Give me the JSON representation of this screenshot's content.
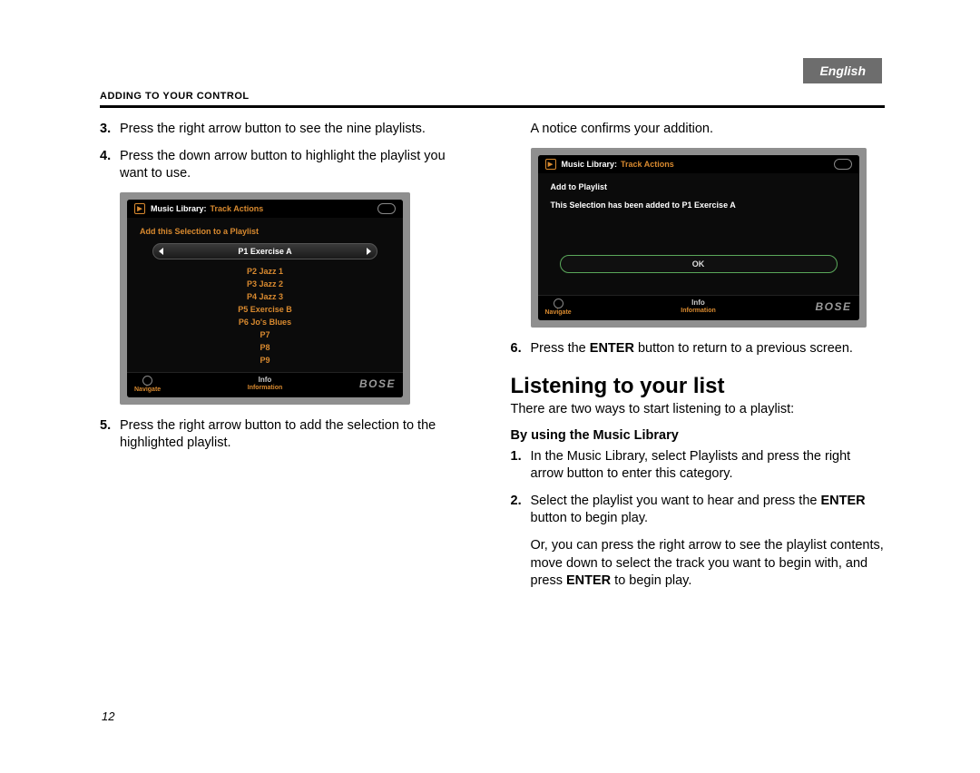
{
  "language_tab": "English",
  "section_header": "Adding to Your Control",
  "page_number": "12",
  "left": {
    "step3": {
      "num": "3.",
      "text": "Press the right arrow button to see the nine playlists."
    },
    "step4": {
      "num": "4.",
      "text": "Press the down arrow button to highlight the playlist you want to use."
    },
    "step5": {
      "num": "5.",
      "text": "Press the right arrow button to add the selection to the highlighted playlist."
    }
  },
  "right": {
    "notice": "A notice confirms your addition.",
    "step6": {
      "num": "6.",
      "text_a": "Press the ",
      "bold1": "ENTER",
      "text_b": " button to return to a previous screen."
    },
    "heading": "Listening to your list",
    "intro": "There are two ways to start listening to a playlist:",
    "subhead": "By using the Music Library",
    "s1": {
      "num": "1.",
      "text": "In the Music Library, select Playlists and press the right arrow button to enter this category."
    },
    "s2": {
      "num": "2.",
      "text_a": "Select the playlist you want to hear and press the ",
      "bold1": "ENTER",
      "text_b": " button to begin play."
    },
    "or": {
      "text_a": "Or, you can press the right arrow to see the playlist contents, move down to select the track you want to begin with, and press ",
      "bold1": "ENTER",
      "text_b": " to begin play."
    }
  },
  "ui1": {
    "title_white": "Music Library:",
    "title_orange": "Track Actions",
    "subtitle": "Add this Selection to a Playlist",
    "selected": "P1 Exercise A",
    "items": [
      "P2 Jazz 1",
      "P3 Jazz 2",
      "P4 Jazz 3",
      "P5 Exercise B",
      "P6 Jo's Blues",
      "P7",
      "P8",
      "P9"
    ],
    "nav": "Navigate",
    "info_word": "Info",
    "info": "Information",
    "brand": "BOSE"
  },
  "ui2": {
    "title_white": "Music Library:",
    "title_orange": "Track Actions",
    "subtitle": "Add to Playlist",
    "message": "This Selection has been added to P1 Exercise A",
    "ok": "OK",
    "nav": "Navigate",
    "info_word": "Info",
    "info": "Information",
    "brand": "BOSE"
  }
}
